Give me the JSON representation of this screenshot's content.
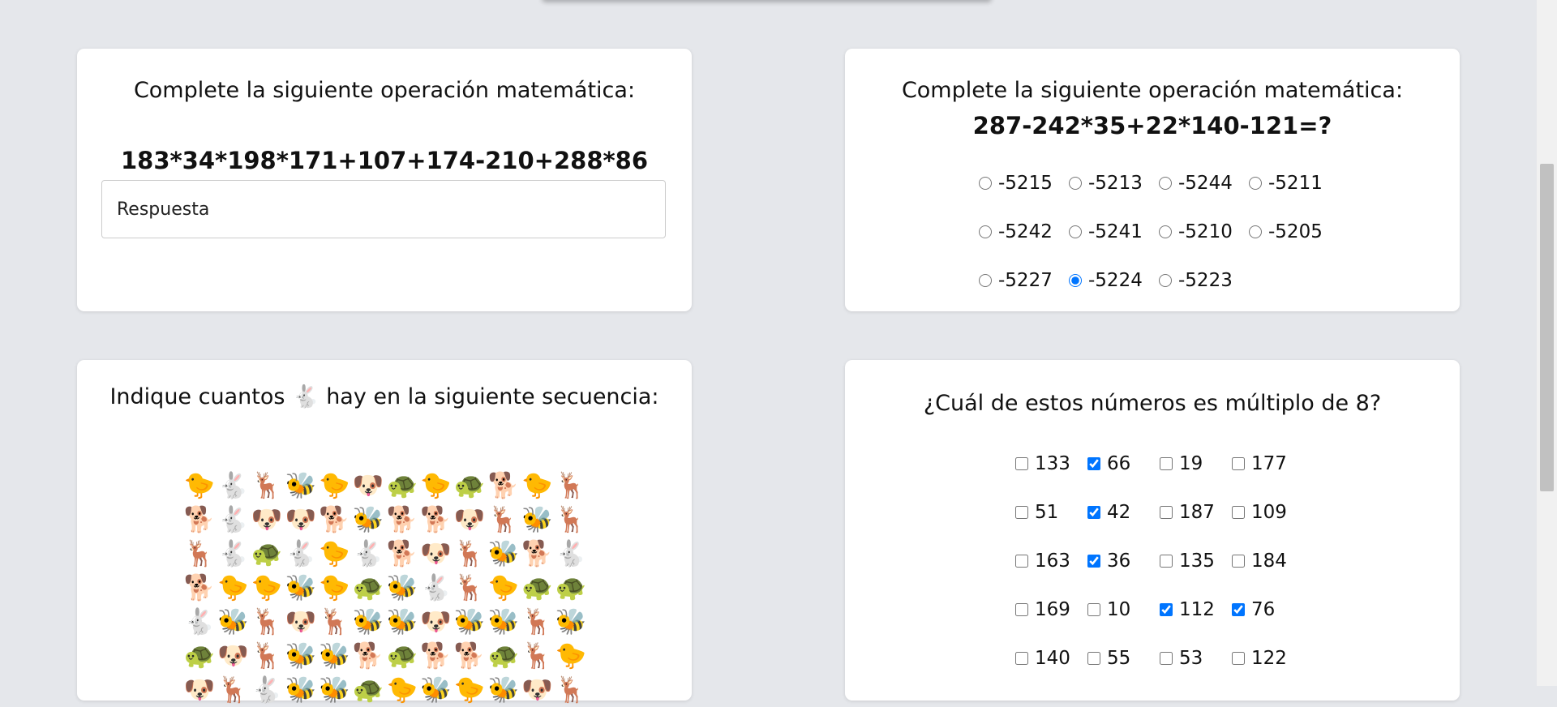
{
  "top_prompt": {
    "question": "Complete la siguiente operación matemática:",
    "expression": "183*34*198*171+107+174-210+288*86",
    "placeholder": "Respuesta"
  },
  "radio_question": {
    "question": "Complete la siguiente operación matemática:",
    "expression": "287-242*35+22*140-121=?",
    "options": [
      [
        "-5215",
        "-5213",
        "-5244",
        "-5211"
      ],
      [
        "-5242",
        "-5241",
        "-5210",
        "-5205"
      ],
      [
        "-5227",
        "-5224",
        "-5223"
      ]
    ],
    "selected": "-5224"
  },
  "emoji_question": {
    "question": "Indique cuantos 🐇 hay en la siguiente secuencia:",
    "rows": [
      [
        "🐤",
        "🐇",
        "🦌",
        "🐝",
        "🐤",
        "🐶",
        "🐢",
        "🐤",
        "🐢",
        "🐕",
        "🐤",
        "🦌"
      ],
      [
        "🐕",
        "🐇",
        "🐶",
        "🐶",
        "🐕",
        "🐝",
        "🐕",
        "🐕",
        "🐶",
        "🦌",
        "🐝",
        "🦌"
      ],
      [
        "🦌",
        "🐇",
        "🐢",
        "🐇",
        "🐤",
        "🐇",
        "🐕",
        "🐶",
        "🦌",
        "🐝",
        "🐕",
        "🐇"
      ],
      [
        "🐕",
        "🐤",
        "🐤",
        "🐝",
        "🐤",
        "🐢",
        "🐝",
        "🐇",
        "🦌",
        "🐤",
        "🐢",
        "🐢"
      ],
      [
        "🐇",
        "🐝",
        "🦌",
        "🐶",
        "🦌",
        "🐝",
        "🐝",
        "🐶",
        "🐝",
        "🐝",
        "🦌",
        "🐝"
      ],
      [
        "🐢",
        "🐶",
        "🦌",
        "🐝",
        "🐝",
        "🐕",
        "🐢",
        "🐕",
        "🐕",
        "🐢",
        "🦌",
        "🐤"
      ],
      [
        "🐶",
        "🦌",
        "🐇",
        "🐝",
        "🐝",
        "🐢",
        "🐤",
        "🐝",
        "🐤",
        "🐝",
        "🐶",
        "🦌"
      ]
    ]
  },
  "checkbox_question": {
    "question": "¿Cuál de estos números es múltiplo de 8?",
    "rows": [
      [
        {
          "label": "133",
          "checked": false
        },
        {
          "label": "66",
          "checked": true
        },
        {
          "label": "19",
          "checked": false
        },
        {
          "label": "177",
          "checked": false
        }
      ],
      [
        {
          "label": "51",
          "checked": false
        },
        {
          "label": "42",
          "checked": true
        },
        {
          "label": "187",
          "checked": false
        },
        {
          "label": "109",
          "checked": false
        }
      ],
      [
        {
          "label": "163",
          "checked": false
        },
        {
          "label": "36",
          "checked": true
        },
        {
          "label": "135",
          "checked": false
        },
        {
          "label": "184",
          "checked": false
        }
      ],
      [
        {
          "label": "169",
          "checked": false
        },
        {
          "label": "10",
          "checked": false
        },
        {
          "label": "112",
          "checked": true
        },
        {
          "label": "76",
          "checked": true
        }
      ],
      [
        {
          "label": "140",
          "checked": false
        },
        {
          "label": "55",
          "checked": false
        },
        {
          "label": "53",
          "checked": false
        },
        {
          "label": "122",
          "checked": false
        }
      ]
    ]
  }
}
